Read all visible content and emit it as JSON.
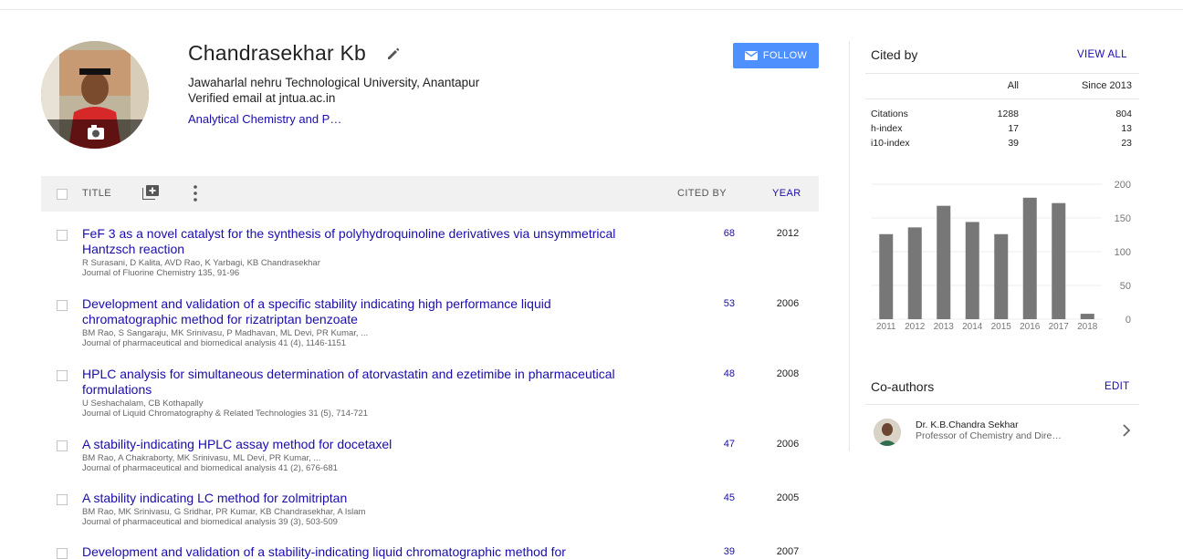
{
  "profile": {
    "name": "Chandrasekhar Kb",
    "affiliation": "Jawaharlal nehru Technological University, Anantapur",
    "email": "Verified email at jntua.ac.in",
    "interest": "Analytical Chemistry and P…",
    "follow_label": "FOLLOW"
  },
  "table": {
    "title_header": "TITLE",
    "cited_header": "CITED BY",
    "year_header": "YEAR",
    "rows": [
      {
        "title": "FeF 3 as a novel catalyst for the synthesis of polyhydroquinoline derivatives via unsymmetrical Hantzsch reaction",
        "authors": "R Surasani, D Kalita, AVD Rao, K Yarbagi, KB Chandrasekhar",
        "venue": "Journal of Fluorine Chemistry 135, 91-96",
        "cited": "68",
        "year": "2012"
      },
      {
        "title": "Development and validation of a specific stability indicating high performance liquid chromatographic method for rizatriptan benzoate",
        "authors": "BM Rao, S Sangaraju, MK Srinivasu, P Madhavan, ML Devi, PR Kumar, ...",
        "venue": "Journal of pharmaceutical and biomedical analysis 41 (4), 1146-1151",
        "cited": "53",
        "year": "2006"
      },
      {
        "title": "HPLC analysis for simultaneous determination of atorvastatin and ezetimibe in pharmaceutical formulations",
        "authors": "U Seshachalam, CB Kothapally",
        "venue": "Journal of Liquid Chromatography & Related Technologies 31 (5), 714-721",
        "cited": "48",
        "year": "2008"
      },
      {
        "title": "A stability-indicating HPLC assay method for docetaxel",
        "authors": "BM Rao, A Chakraborty, MK Srinivasu, ML Devi, PR Kumar, ...",
        "venue": "Journal of pharmaceutical and biomedical analysis 41 (2), 676-681",
        "cited": "47",
        "year": "2006"
      },
      {
        "title": "A stability indicating LC method for zolmitriptan",
        "authors": "BM Rao, MK Srinivasu, G Sridhar, PR Kumar, KB Chandrasekhar, A Islam",
        "venue": "Journal of pharmaceutical and biomedical analysis 39 (3), 503-509",
        "cited": "45",
        "year": "2005"
      },
      {
        "title": "Development and validation of a stability-indicating liquid chromatographic method for",
        "authors": "",
        "venue": "",
        "cited": "39",
        "year": "2007"
      }
    ]
  },
  "cited_by": {
    "heading": "Cited by",
    "view_all": "VIEW ALL",
    "col_all": "All",
    "col_since": "Since 2013",
    "metrics": [
      {
        "label": "Citations",
        "all": "1288",
        "since": "804"
      },
      {
        "label": "h-index",
        "all": "17",
        "since": "13"
      },
      {
        "label": "i10-index",
        "all": "39",
        "since": "23"
      }
    ]
  },
  "chart_data": {
    "type": "bar",
    "categories": [
      "2011",
      "2012",
      "2013",
      "2014",
      "2015",
      "2016",
      "2017",
      "2018"
    ],
    "values": [
      126,
      136,
      168,
      144,
      126,
      180,
      172,
      8
    ],
    "ylim": [
      0,
      200
    ],
    "yticks": [
      0,
      50,
      100,
      150,
      200
    ],
    "bar_color": "#777777",
    "grid": true
  },
  "coauthors": {
    "heading": "Co-authors",
    "edit_label": "EDIT",
    "items": [
      {
        "name": "Dr. K.B.Chandra Sekhar",
        "affiliation": "Professor of Chemistry and Dire…"
      }
    ]
  },
  "colors": {
    "link": "#1a0dab",
    "button": "#4d90fe"
  }
}
